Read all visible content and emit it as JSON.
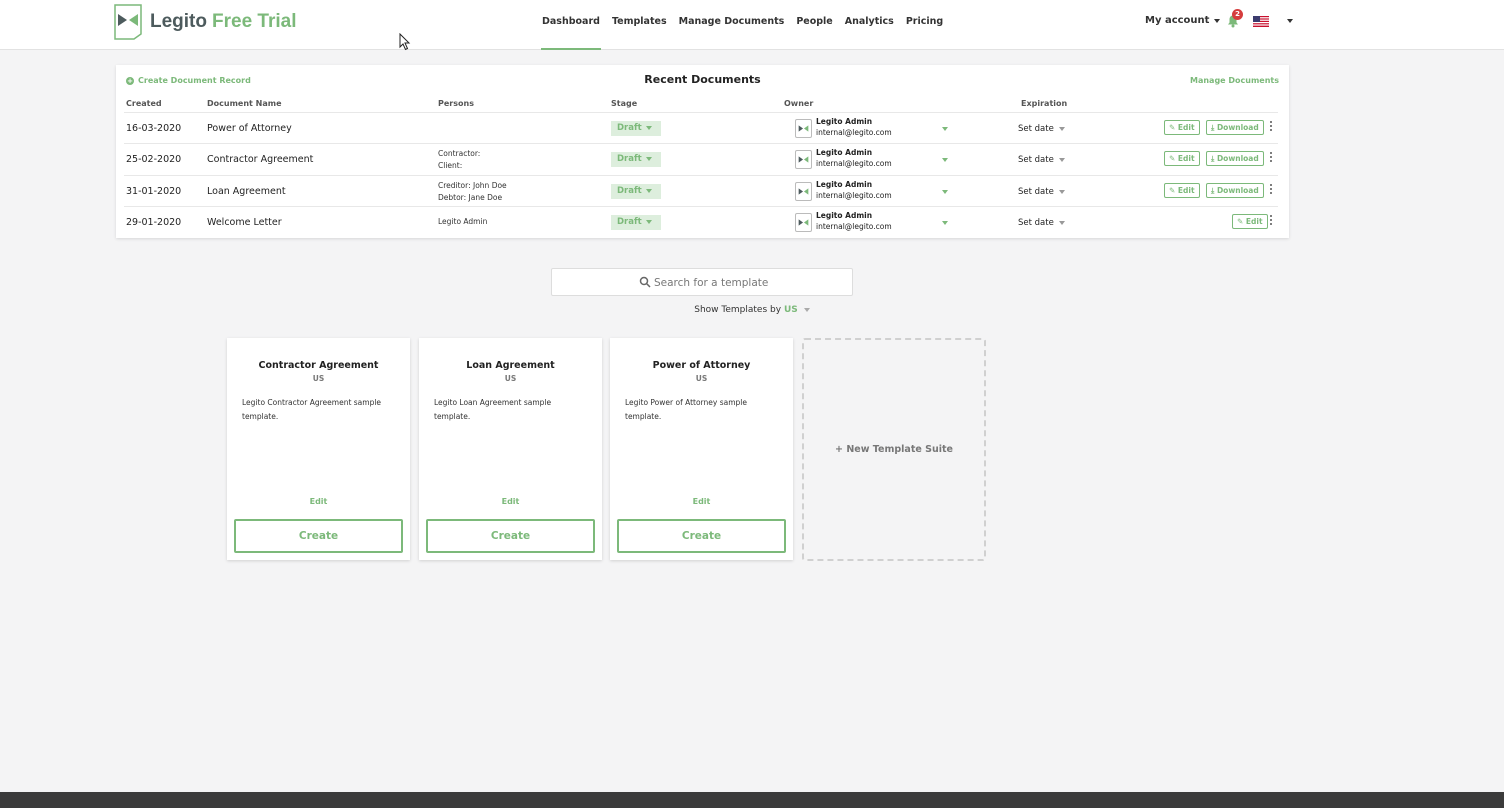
{
  "brand": {
    "name": "Legito",
    "trial": "Free Trial"
  },
  "nav": [
    "Dashboard",
    "Templates",
    "Manage Documents",
    "People",
    "Analytics",
    "Pricing"
  ],
  "account": {
    "label": "My account",
    "notifications": "2"
  },
  "docs": {
    "title": "Recent Documents",
    "create": "Create Document Record",
    "manage": "Manage Documents",
    "columns": {
      "created": "Created",
      "name": "Document Name",
      "persons": "Persons",
      "stage": "Stage",
      "owner": "Owner",
      "expiration": "Expiration"
    },
    "rows": [
      {
        "created": "16-03-2020",
        "name": "Power of Attorney",
        "person1": "",
        "person2": "",
        "stage": "Draft",
        "owner": "Legito Admin",
        "email": "internal@legito.com",
        "exp": "Set date",
        "edit": "Edit",
        "download": "Download"
      },
      {
        "created": "25-02-2020",
        "name": "Contractor Agreement",
        "person1": "Contractor:",
        "person2": "Client:",
        "stage": "Draft",
        "owner": "Legito Admin",
        "email": "internal@legito.com",
        "exp": "Set date",
        "edit": "Edit",
        "download": "Download"
      },
      {
        "created": "31-01-2020",
        "name": "Loan Agreement",
        "person1": "Creditor: John Doe",
        "person2": "Debtor: Jane Doe",
        "stage": "Draft",
        "owner": "Legito Admin",
        "email": "internal@legito.com",
        "exp": "Set date",
        "edit": "Edit",
        "download": "Download"
      },
      {
        "created": "29-01-2020",
        "name": "Welcome Letter",
        "person1": "Legito Admin",
        "person2": "",
        "stage": "Draft",
        "owner": "Legito Admin",
        "email": "internal@legito.com",
        "exp": "Set date",
        "edit": "Edit",
        "download": ""
      }
    ]
  },
  "search": {
    "placeholder": "Search for a template"
  },
  "show_by": {
    "label": "Show Templates by",
    "country": "US"
  },
  "templates": [
    {
      "title": "Contractor Agreement",
      "country": "US",
      "desc": "Legito Contractor Agreement sample template.",
      "edit": "Edit",
      "create": "Create"
    },
    {
      "title": "Loan Agreement",
      "country": "US",
      "desc": "Legito Loan Agreement sample template.",
      "edit": "Edit",
      "create": "Create"
    },
    {
      "title": "Power of Attorney",
      "country": "US",
      "desc": "Legito Power of Attorney sample template.",
      "edit": "Edit",
      "create": "Create"
    }
  ],
  "new_suite": "New Template Suite",
  "colors": {
    "accent": "#7cb97a",
    "brand_text": "#4d5b5d",
    "badge": "#d53d3d"
  }
}
